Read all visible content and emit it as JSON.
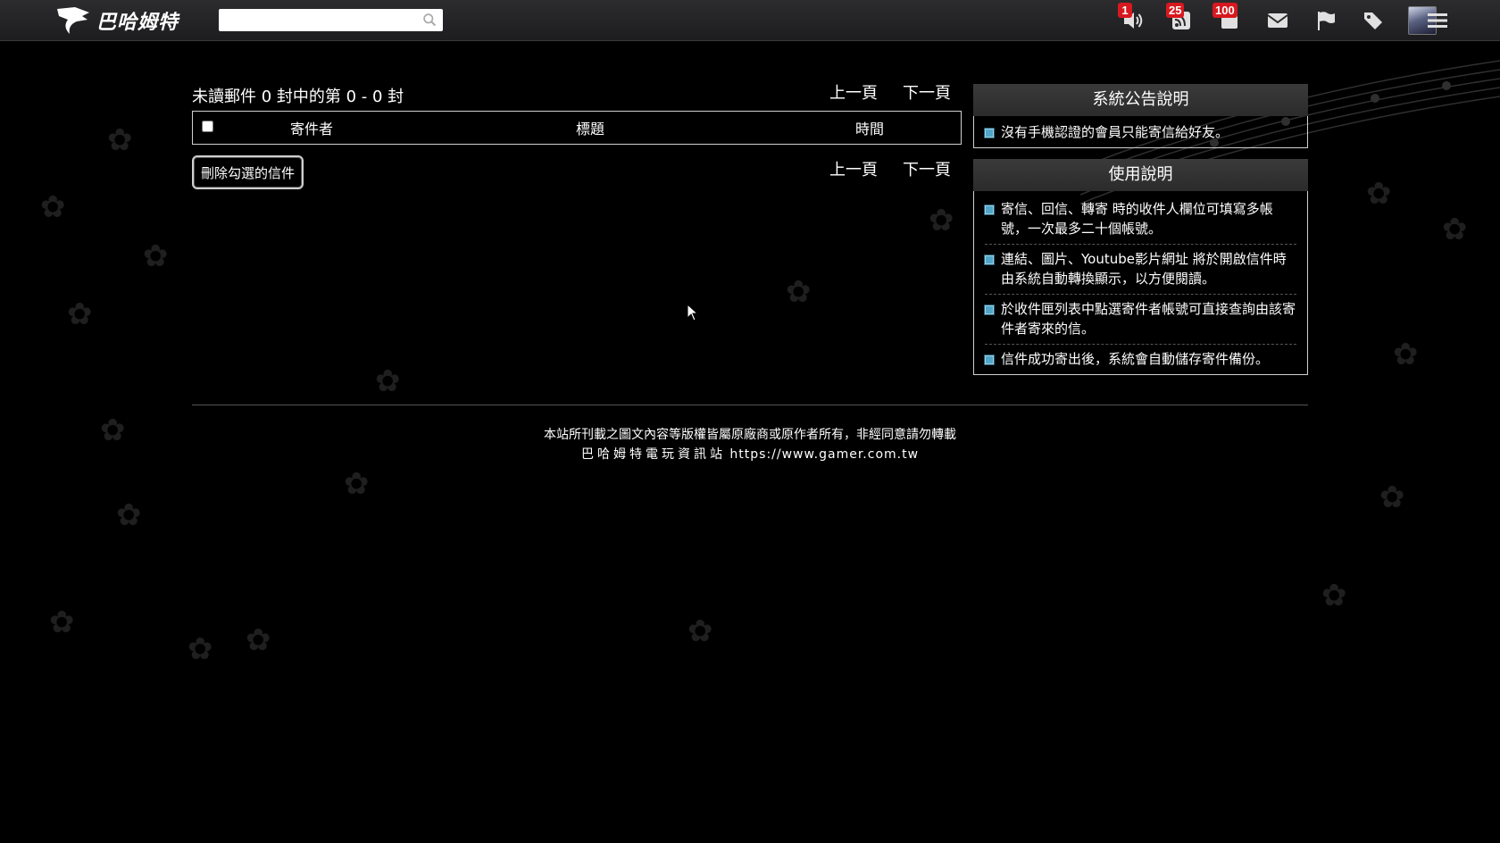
{
  "topbar": {
    "logo_text": "巴哈姆特",
    "search": {
      "value": "",
      "placeholder": ""
    },
    "icons": [
      {
        "name": "speaker-icon",
        "badge": "1"
      },
      {
        "name": "rss-icon",
        "badge": "25"
      },
      {
        "name": "stack-icon",
        "badge": "100"
      },
      {
        "name": "mail-icon",
        "badge": ""
      },
      {
        "name": "flag-icon",
        "badge": ""
      },
      {
        "name": "tag-icon",
        "badge": ""
      }
    ],
    "avatar_icon": "avatar",
    "menu_icon": "hamburger-menu-icon"
  },
  "mailbox": {
    "count_text": "未讀郵件 0 封中的第 0 - 0 封",
    "prev_label": "上一頁",
    "next_label": "下一頁",
    "columns": [
      "寄件者",
      "標題",
      "時間"
    ],
    "rows": [],
    "delete_button": "刪除勾選的信件"
  },
  "sidebar": {
    "announcement": {
      "title": "系統公告說明",
      "items": [
        "沒有手機認證的會員只能寄信給好友。"
      ]
    },
    "usage": {
      "title": "使用說明",
      "items": [
        "寄信、回信、轉寄 時的收件人欄位可填寫多帳號，一次最多二十個帳號。",
        "連結、圖片、Youtube影片網址 將於開啟信件時由系統自動轉換顯示，以方便閱讀。",
        "於收件匣列表中點選寄件者帳號可直接查詢由該寄件者寄來的信。",
        "信件成功寄出後，系統會自動儲存寄件備份。"
      ]
    }
  },
  "footer": {
    "copyright": "本站所刊載之圖文內容等版權皆屬原廠商或原作者所有，非經同意請勿轉載",
    "site_name": "巴哈姆特電玩資訊站",
    "site_url": "https://www.gamer.com.tw"
  },
  "colors": {
    "background": "#000000",
    "topbar": "#2a2a2c",
    "badge": "#d7191f",
    "bullet": "#4fa6c8"
  }
}
